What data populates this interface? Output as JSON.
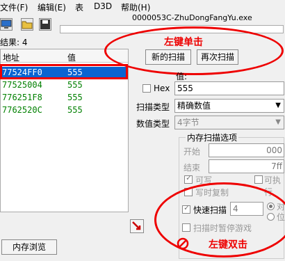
{
  "menu": [
    "文件(F)",
    "编辑(E)",
    "表",
    "D3D",
    "帮助(H)"
  ],
  "process_title": "0000053C-ZhuDongFangYu.exe",
  "results_label": "结果: 4",
  "list": {
    "headers": [
      "地址",
      "值"
    ],
    "rows": [
      {
        "address": "77524FF0",
        "value": "555"
      },
      {
        "address": "77525004",
        "value": "555"
      },
      {
        "address": "776251F8",
        "value": "555"
      },
      {
        "address": "7762520C",
        "value": "555"
      }
    ]
  },
  "buttons": {
    "new_scan": "新的扫描",
    "next_scan": "再次扫描",
    "memory_view": "内存浏览"
  },
  "annotations": {
    "single_click": "左键单击",
    "double_click": "左键双击"
  },
  "value_label": "值:",
  "hex_label": "Hex",
  "value_input": "555",
  "scan_type": {
    "label": "扫描类型",
    "value": "精确数值"
  },
  "value_type": {
    "label": "数值类型",
    "value": "4字节"
  },
  "memory_options": {
    "title": "内存扫描选项",
    "start_label": "开始",
    "start_value": "000",
    "end_label": "结束",
    "end_value": "7ff",
    "writable": "可写",
    "executable": "可执行",
    "copy_on_write": "写时复制",
    "fast_scan": "快速扫描",
    "fast_scan_value": "4",
    "align": "对",
    "last_digit": "位",
    "pause_game": "扫描时暂停游戏"
  },
  "colors": {
    "annotation": "#e00000",
    "selection": "#0a64d2",
    "value_text": "#008000"
  }
}
